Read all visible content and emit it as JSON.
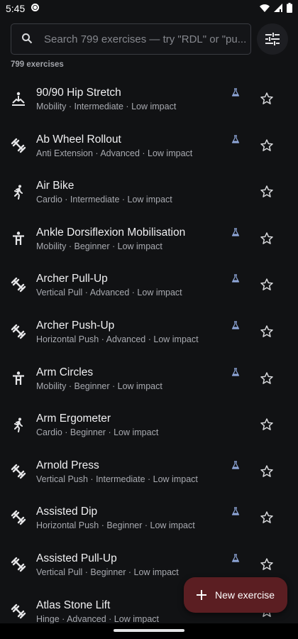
{
  "status_bar": {
    "time": "5:45"
  },
  "search": {
    "placeholder": "Search 799 exercises — try \"RDL\" or \"pu..."
  },
  "exercise_count": "799 exercises",
  "exercises": [
    {
      "name": "90/90 Hip Stretch",
      "details": "Mobility · Intermediate · Low impact",
      "icon": "mobility-icon",
      "flask": true
    },
    {
      "name": "Ab Wheel Rollout",
      "details": "Anti Extension · Advanced · Low impact",
      "icon": "dumbbell-icon",
      "flask": true
    },
    {
      "name": "Air Bike",
      "details": "Cardio · Intermediate · Low impact",
      "icon": "running-icon",
      "flask": false
    },
    {
      "name": "Ankle Dorsiflexion Mobilisation",
      "details": "Mobility · Beginner · Low impact",
      "icon": "person-icon",
      "flask": true
    },
    {
      "name": "Archer Pull-Up",
      "details": "Vertical Pull · Advanced · Low impact",
      "icon": "dumbbell-icon",
      "flask": true
    },
    {
      "name": "Archer Push-Up",
      "details": "Horizontal Push · Advanced · Low impact",
      "icon": "dumbbell-icon",
      "flask": true
    },
    {
      "name": "Arm Circles",
      "details": "Mobility · Beginner · Low impact",
      "icon": "person-icon",
      "flask": true
    },
    {
      "name": "Arm Ergometer",
      "details": "Cardio · Beginner · Low impact",
      "icon": "running-icon",
      "flask": false
    },
    {
      "name": "Arnold Press",
      "details": "Vertical Push · Intermediate · Low impact",
      "icon": "dumbbell-icon",
      "flask": true
    },
    {
      "name": "Assisted Dip",
      "details": "Horizontal Push · Beginner · Low impact",
      "icon": "dumbbell-icon",
      "flask": true
    },
    {
      "name": "Assisted Pull-Up",
      "details": "Vertical Pull · Beginner · Low impact",
      "icon": "dumbbell-icon",
      "flask": true
    },
    {
      "name": "Atlas Stone Lift",
      "details": "Hinge · Advanced · Low impact",
      "icon": "dumbbell-icon",
      "flask": false
    }
  ],
  "fab": {
    "label": "New exercise"
  },
  "colors": {
    "background": "#111214",
    "accent_flask": "#8ea6d8",
    "fab": "#5b1e22"
  }
}
